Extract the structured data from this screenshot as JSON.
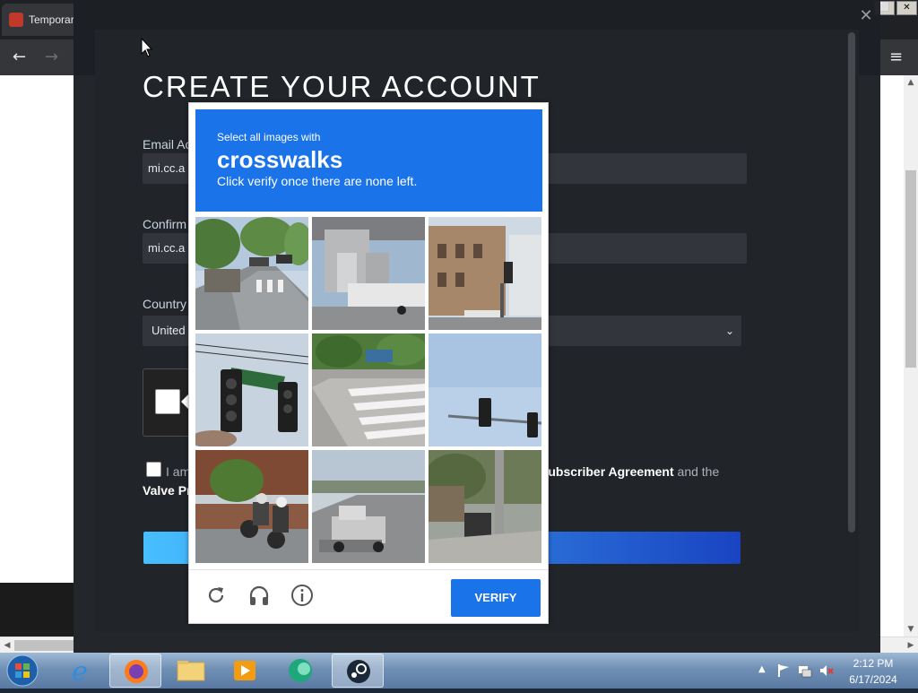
{
  "browser": {
    "tab_title": "Temporar",
    "win_buttons": [
      "⬜",
      "✕"
    ],
    "nav": {
      "back": "←",
      "forward": "→",
      "menu": "≡"
    }
  },
  "overlay": {
    "close": "✕"
  },
  "form": {
    "title": "CREATE YOUR ACCOUNT",
    "email_label": "Email Ac",
    "email_value": "mi.cc.a",
    "confirm_label": "Confirm",
    "confirm_value": "mi.cc.a",
    "country_label": "Country",
    "country_value": "United",
    "agree_prefix": "I am",
    "agree_link": "Subscriber Agreement",
    "agree_suffix": "and the",
    "privacy_link": "Valve Pr"
  },
  "captcha": {
    "instruction": "Select all images with",
    "target": "crosswalks",
    "hint": "Click verify once there are none left.",
    "verify_label": "VERIFY",
    "tiles": [
      "street-with-crosswalk-and-trees",
      "concrete-overpass-pillar-truck",
      "building-with-traffic-light",
      "traffic-lights-street-sign",
      "crosswalk-stripes-road",
      "traffic-light-sky",
      "motorcycles-on-street",
      "tow-truck-on-highway",
      "sidewalk-with-pole"
    ],
    "footer_icons": [
      "reload-icon",
      "audio-icon",
      "info-icon"
    ]
  },
  "taskbar": {
    "apps": [
      "internet-explorer",
      "firefox",
      "file-explorer",
      "media-player",
      "browser-app",
      "steam"
    ],
    "time": "2:12 PM",
    "date": "6/17/2024"
  },
  "colors": {
    "captcha_blue": "#1a73e8",
    "steam_bg": "#212429"
  }
}
